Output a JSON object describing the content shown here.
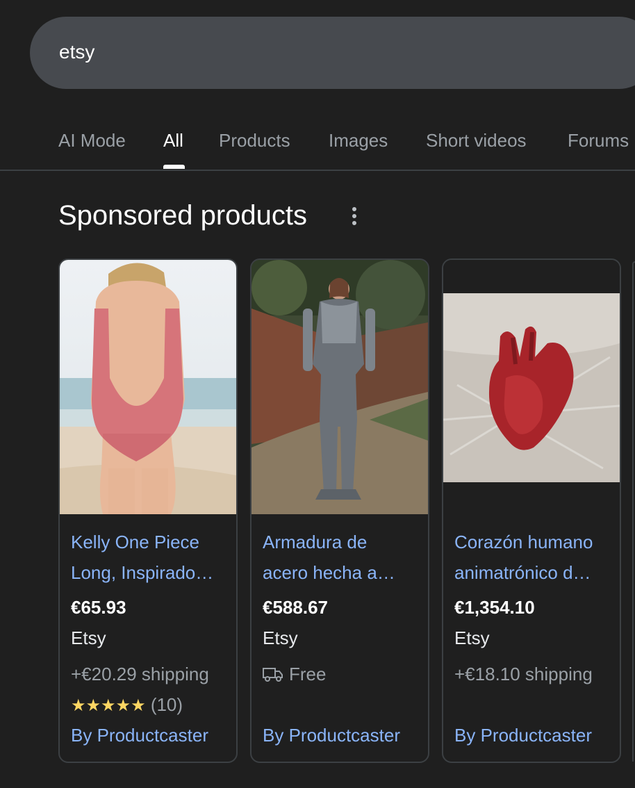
{
  "search": {
    "query": "etsy"
  },
  "tabs": [
    {
      "label": "AI Mode"
    },
    {
      "label": "All"
    },
    {
      "label": "Products"
    },
    {
      "label": "Images"
    },
    {
      "label": "Short videos"
    },
    {
      "label": "Forums"
    }
  ],
  "active_tab": "All",
  "section": {
    "title": "Sponsored products"
  },
  "products": [
    {
      "title_line1": "Kelly One Piece",
      "title_line2": "Long, Inspirado…",
      "price": "€65.93",
      "merchant": "Etsy",
      "shipping": "+€20.29 shipping",
      "rating_stars": "★★★★★",
      "rating_count": "(10)",
      "by": "By Productcaster"
    },
    {
      "title_line1": "Armadura de",
      "title_line2": "acero hecha a…",
      "price": "€588.67",
      "merchant": "Etsy",
      "shipping": "Free",
      "shipping_icon": "truck-icon",
      "by": "By Productcaster"
    },
    {
      "title_line1": "Corazón humano",
      "title_line2": "animatrónico d…",
      "price": "€1,354.10",
      "merchant": "Etsy",
      "shipping": "+€18.10 shipping",
      "by": "By Productcaster"
    }
  ],
  "colors": {
    "background": "#1f1f1f",
    "search_bar": "#474a4f",
    "link": "#8ab4f8",
    "muted": "#9aa0a6",
    "star": "#fdd663"
  }
}
